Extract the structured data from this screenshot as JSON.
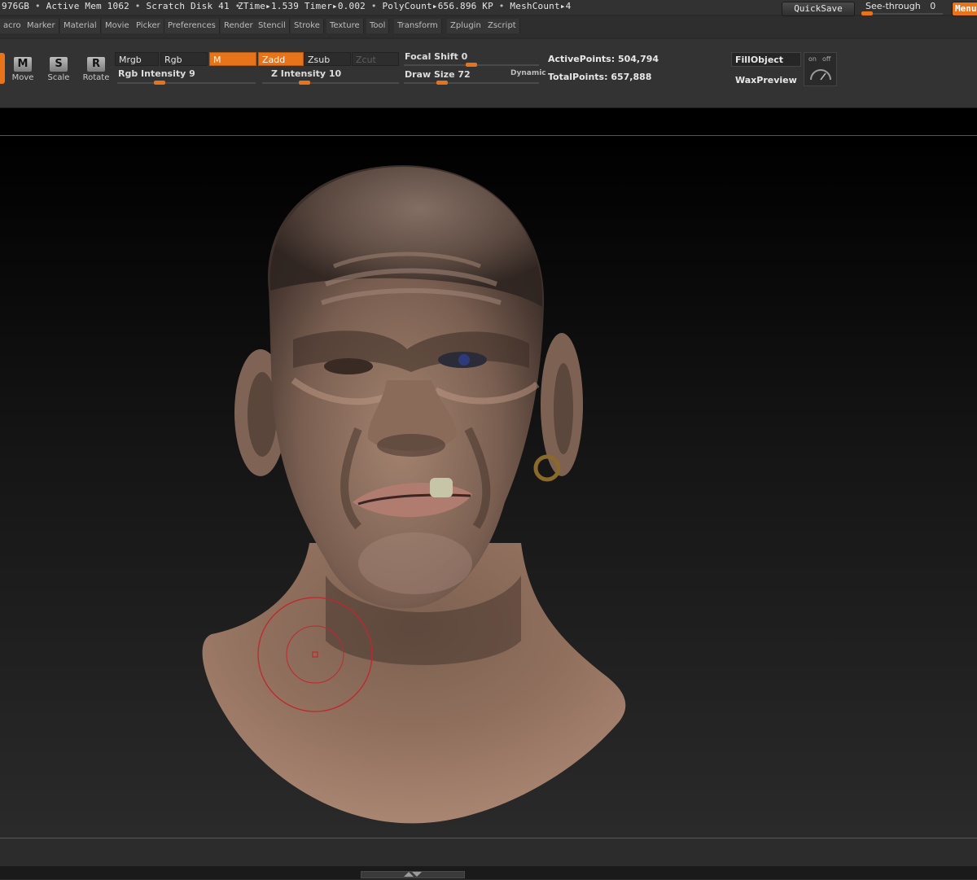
{
  "status": {
    "mem_fragment": "976GB",
    "active_mem_label": "Active Mem",
    "active_mem_value": "1062",
    "scratch_label": "Scratch Disk",
    "scratch_value": "41",
    "ztime_label": "ZTime",
    "ztime_value": "1.539",
    "timer_label": "Timer",
    "timer_value": "0.002",
    "polycount_label": "PolyCount",
    "polycount_value": "656.896 KP",
    "meshcount_label": "MeshCount",
    "meshcount_value": "4",
    "quicksave": "QuickSave",
    "see_through_label": "See-through",
    "see_through_value": "0",
    "see_through_level": 0,
    "menus_button": "Menus"
  },
  "menubar": {
    "items": [
      "acro",
      "Marker",
      "Material",
      "Movie",
      "Picker",
      "Preferences",
      "Render",
      "Stencil",
      "Stroke",
      "Texture",
      "Tool",
      "Transform",
      "Zplugin",
      "Zscript"
    ]
  },
  "shelf": {
    "tools": [
      {
        "letter": "M",
        "label": "Move",
        "icon": "move-icon"
      },
      {
        "letter": "S",
        "label": "Scale",
        "icon": "scale-icon"
      },
      {
        "letter": "R",
        "label": "Rotate",
        "icon": "rotate-icon"
      }
    ],
    "mrgb": "Mrgb",
    "rgb": "Rgb",
    "m": "M",
    "zadd": "Zadd",
    "zsub": "Zsub",
    "zcut": "Zcut",
    "rgb_intensity_label": "Rgb Intensity",
    "rgb_intensity_value": "9",
    "z_intensity_label": "Z Intensity",
    "z_intensity_value": "10",
    "focal_shift_label": "Focal Shift",
    "focal_shift_value": "0",
    "draw_size_label": "Draw Size",
    "draw_size_value": "72",
    "dynamic_label": "Dynamic",
    "active_points_label": "ActivePoints:",
    "active_points_value": "504,794",
    "total_points_label": "TotalPoints:",
    "total_points_value": "657,888",
    "fill_object": "FillObject",
    "wax_preview": "WaxPreview",
    "on_label": "on",
    "off_label": "off"
  },
  "colors": {
    "accent": "#e7731a",
    "brush_ring": "#c0272d",
    "skin": "#8a6b5a"
  }
}
